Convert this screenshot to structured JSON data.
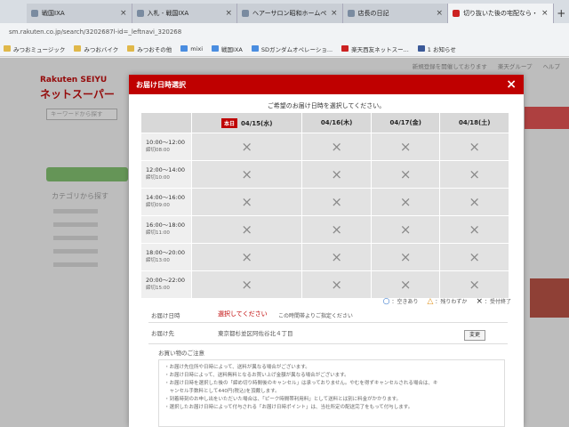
{
  "browser": {
    "tabs": [
      {
        "title": "戦国IXA"
      },
      {
        "title": "入札 - 戦国IXA"
      },
      {
        "title": "ヘアーサロン昭和ホームページ"
      },
      {
        "title": "店長の日記"
      },
      {
        "title": "切り抜いた後の宅配なら・楽天"
      }
    ],
    "address": "sm.rakuten.co.jp/search/3202687l-id=_leftnavi_320268",
    "bookmarks": [
      {
        "label": "みつおミュージック"
      },
      {
        "label": "みつおバイク"
      },
      {
        "label": "みつおその他"
      },
      {
        "label": "mixi"
      },
      {
        "label": "戦国IXA"
      },
      {
        "label": "SDガンダムオペレーショ..."
      },
      {
        "label": "楽天西友ネットスー..."
      },
      {
        "label": "1 お知らせ"
      }
    ]
  },
  "background": {
    "logo_line1": "Rakuten SEIYU",
    "logo_line2": "ネットスーパー",
    "search_placeholder": "キーワードから探す",
    "category_title": "カテゴリから探す",
    "topnav": [
      "新規登録を開催しております",
      "楽天グループ",
      "ヘルプ"
    ]
  },
  "modal": {
    "title": "お届け日時選択",
    "close": "×",
    "instruction": "ご希望のお届け日時を選択してください。",
    "today_badge": "本日",
    "dates": [
      "04/15(水)",
      "04/16(木)",
      "04/17(金)",
      "04/18(土)"
    ],
    "slots": [
      {
        "time": "10:00〜12:00",
        "sub": "締切08:00",
        "status": [
          "×",
          "×",
          "×",
          "×"
        ]
      },
      {
        "time": "12:00〜14:00",
        "sub": "締切10:00",
        "status": [
          "×",
          "×",
          "×",
          "×"
        ]
      },
      {
        "time": "14:00〜16:00",
        "sub": "締切09:00",
        "status": [
          "×",
          "×",
          "×",
          "×"
        ]
      },
      {
        "time": "16:00〜18:00",
        "sub": "締切11:00",
        "status": [
          "×",
          "×",
          "×",
          "×"
        ]
      },
      {
        "time": "18:00〜20:00",
        "sub": "締切13:00",
        "status": [
          "×",
          "×",
          "×",
          "×"
        ]
      },
      {
        "time": "20:00〜22:00",
        "sub": "締切15:00",
        "status": [
          "×",
          "×",
          "×",
          "×"
        ]
      }
    ],
    "legend": [
      {
        "symbol": "○",
        "label": "：空きあり",
        "color": "#2a6fc9"
      },
      {
        "symbol": "△",
        "label": "：残りわずか",
        "color": "#e0901a"
      },
      {
        "symbol": "×",
        "label": "：受付終了",
        "color": "#333333"
      }
    ],
    "delivery_date_label": "お届け日時",
    "delivery_date_value": "選択してください",
    "delivery_date_note": "この時間帯よりご指定ください",
    "delivery_to_label": "お届け先",
    "delivery_to_value": "東京都杉並区阿佐谷北４丁目",
    "change_button": "変更",
    "notes_title": "お買い物のご注意",
    "notes": [
      "・お届け先住所や日時によって、送料が異なる場合がございます。",
      "・お届け日時によって、送料無料となるお買い上げ金額が異なる場合がございます。",
      "・お届け日時を選択した後の「締め切り時間後のキャンセル」は承っておりません。やむを得ずキャンセルされる場合は、キ",
      "　ャンセル手数料として440円(税込)を頂戴します。",
      "・到着時刻のお申し出をいただいた場合は、「ピーク時間帯利用料」として送料とは別に料金がかかります。",
      "・選択したお届け日時によって付与される「お届け日時ポイント」は、当社所定の配送完了をもって付与します。"
    ]
  }
}
